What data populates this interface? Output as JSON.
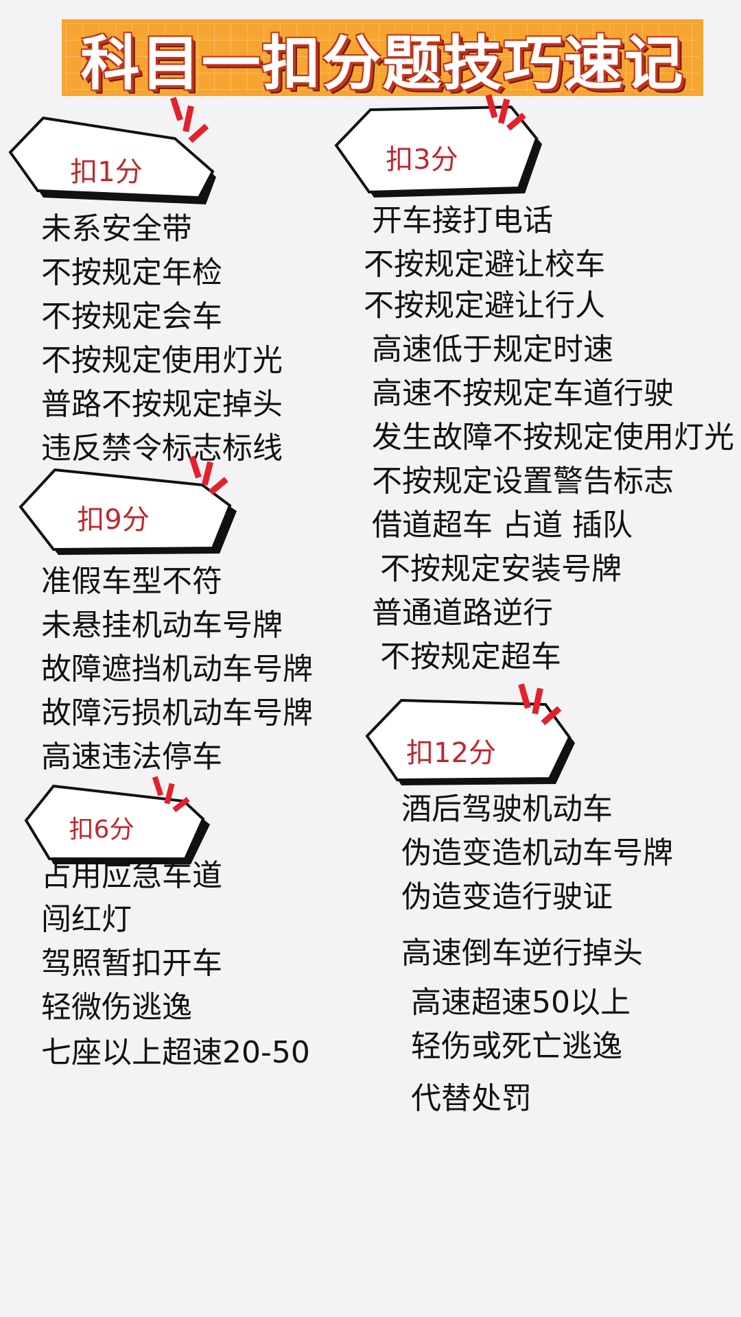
{
  "title": "科目一扣分题技巧速记",
  "sections": {
    "s1": {
      "badge": "扣1分",
      "items": [
        "未系安全带",
        "不按规定年检",
        "不按规定会车",
        "不按规定使用灯光",
        "普路不按规定掉头",
        "违反禁令标志标线"
      ]
    },
    "s9": {
      "badge": "扣9分",
      "items": [
        "准假车型不符",
        "未悬挂机动车号牌",
        "故障遮挡机动车号牌",
        "故障污损机动车号牌",
        "高速违法停车"
      ]
    },
    "s6": {
      "badge": "扣6分",
      "items": [
        "占用应急车道",
        "闯红灯",
        "驾照暂扣开车",
        "轻微伤逃逸",
        "七座以上超速20-50"
      ]
    },
    "s3": {
      "badge": "扣3分",
      "items": [
        "开车接打电话",
        "不按规定避让校车",
        "不按规定避让行人",
        "高速低于规定时速",
        "高速不按规定车道行驶",
        "发生故障不按规定使用灯光",
        "不按规定设置警告标志",
        "借道超车 占道 插队",
        "不按规定安装号牌",
        "普通道路逆行",
        "不按规定超车"
      ]
    },
    "s12": {
      "badge": "扣12分",
      "items": [
        "酒后驾驶机动车",
        "伪造变造机动车号牌",
        "伪造变造行驶证",
        "高速倒车逆行掉头",
        "高速超速50以上",
        "轻伤或死亡逃逸",
        "代替处罚"
      ]
    }
  },
  "colors": {
    "accent": "#c0262d",
    "title_bg": "#f7a531",
    "mark_red": "#e4202a"
  }
}
